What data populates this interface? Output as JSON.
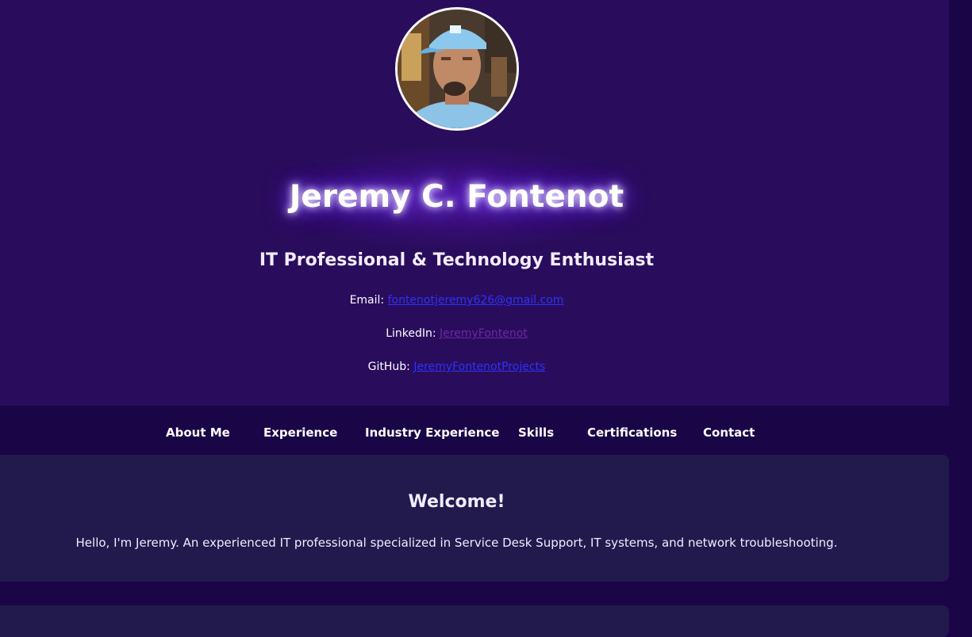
{
  "header": {
    "avatar_alt": "Profile photo",
    "name": "Jeremy C. Fontenot",
    "tagline": "IT Professional & Technology Enthusiast",
    "contacts": [
      {
        "label": "Email:",
        "link": "fontenotjeremy626@gmail.com"
      },
      {
        "label": "LinkedIn:",
        "link": "JeremyFontenot"
      },
      {
        "label": "GitHub:",
        "link": "JeremyFontenotProjects"
      }
    ]
  },
  "nav": {
    "items": [
      "About Me",
      "Experience",
      "Industry Experience",
      "Skills",
      "Certifications",
      "Contact"
    ]
  },
  "welcome": {
    "title": "Welcome!",
    "text": "Hello, I'm Jeremy. An experienced IT professional specialized in Service Desk Support, IT systems, and network troubleshooting."
  },
  "colors": {
    "header_bg": "#2a0c5c",
    "page_bg": "#1a0547",
    "card_bg": "#221a4d",
    "link": "#2a33ff",
    "link_visited": "#6a2aa0"
  }
}
